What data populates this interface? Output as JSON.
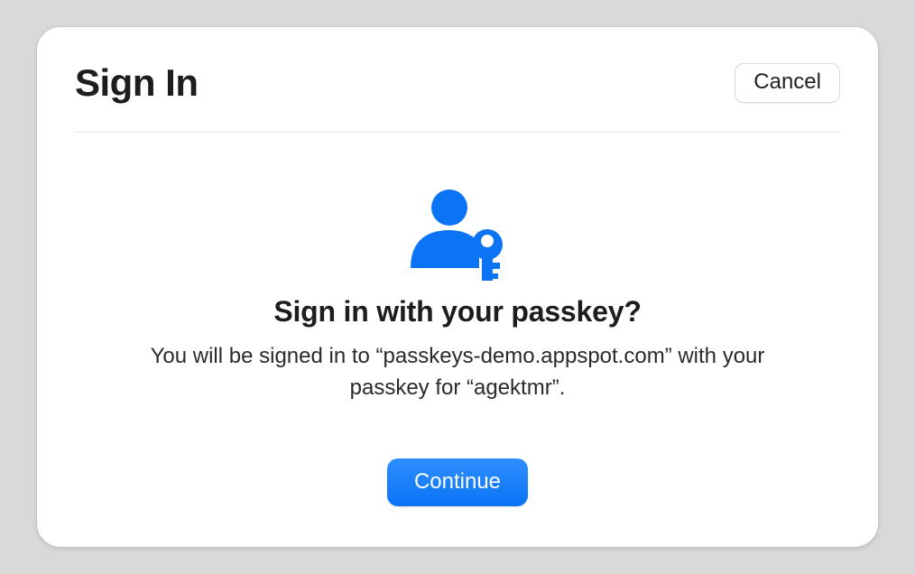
{
  "header": {
    "title": "Sign In",
    "cancel_label": "Cancel"
  },
  "body": {
    "prompt_title": "Sign in with your passkey?",
    "prompt_description": "You will be signed in to “passkeys-demo.appspot.com” with your passkey for “agektmr”.",
    "continue_label": "Continue"
  },
  "colors": {
    "accent": "#0a74f5",
    "icon": "#0a74f5"
  }
}
